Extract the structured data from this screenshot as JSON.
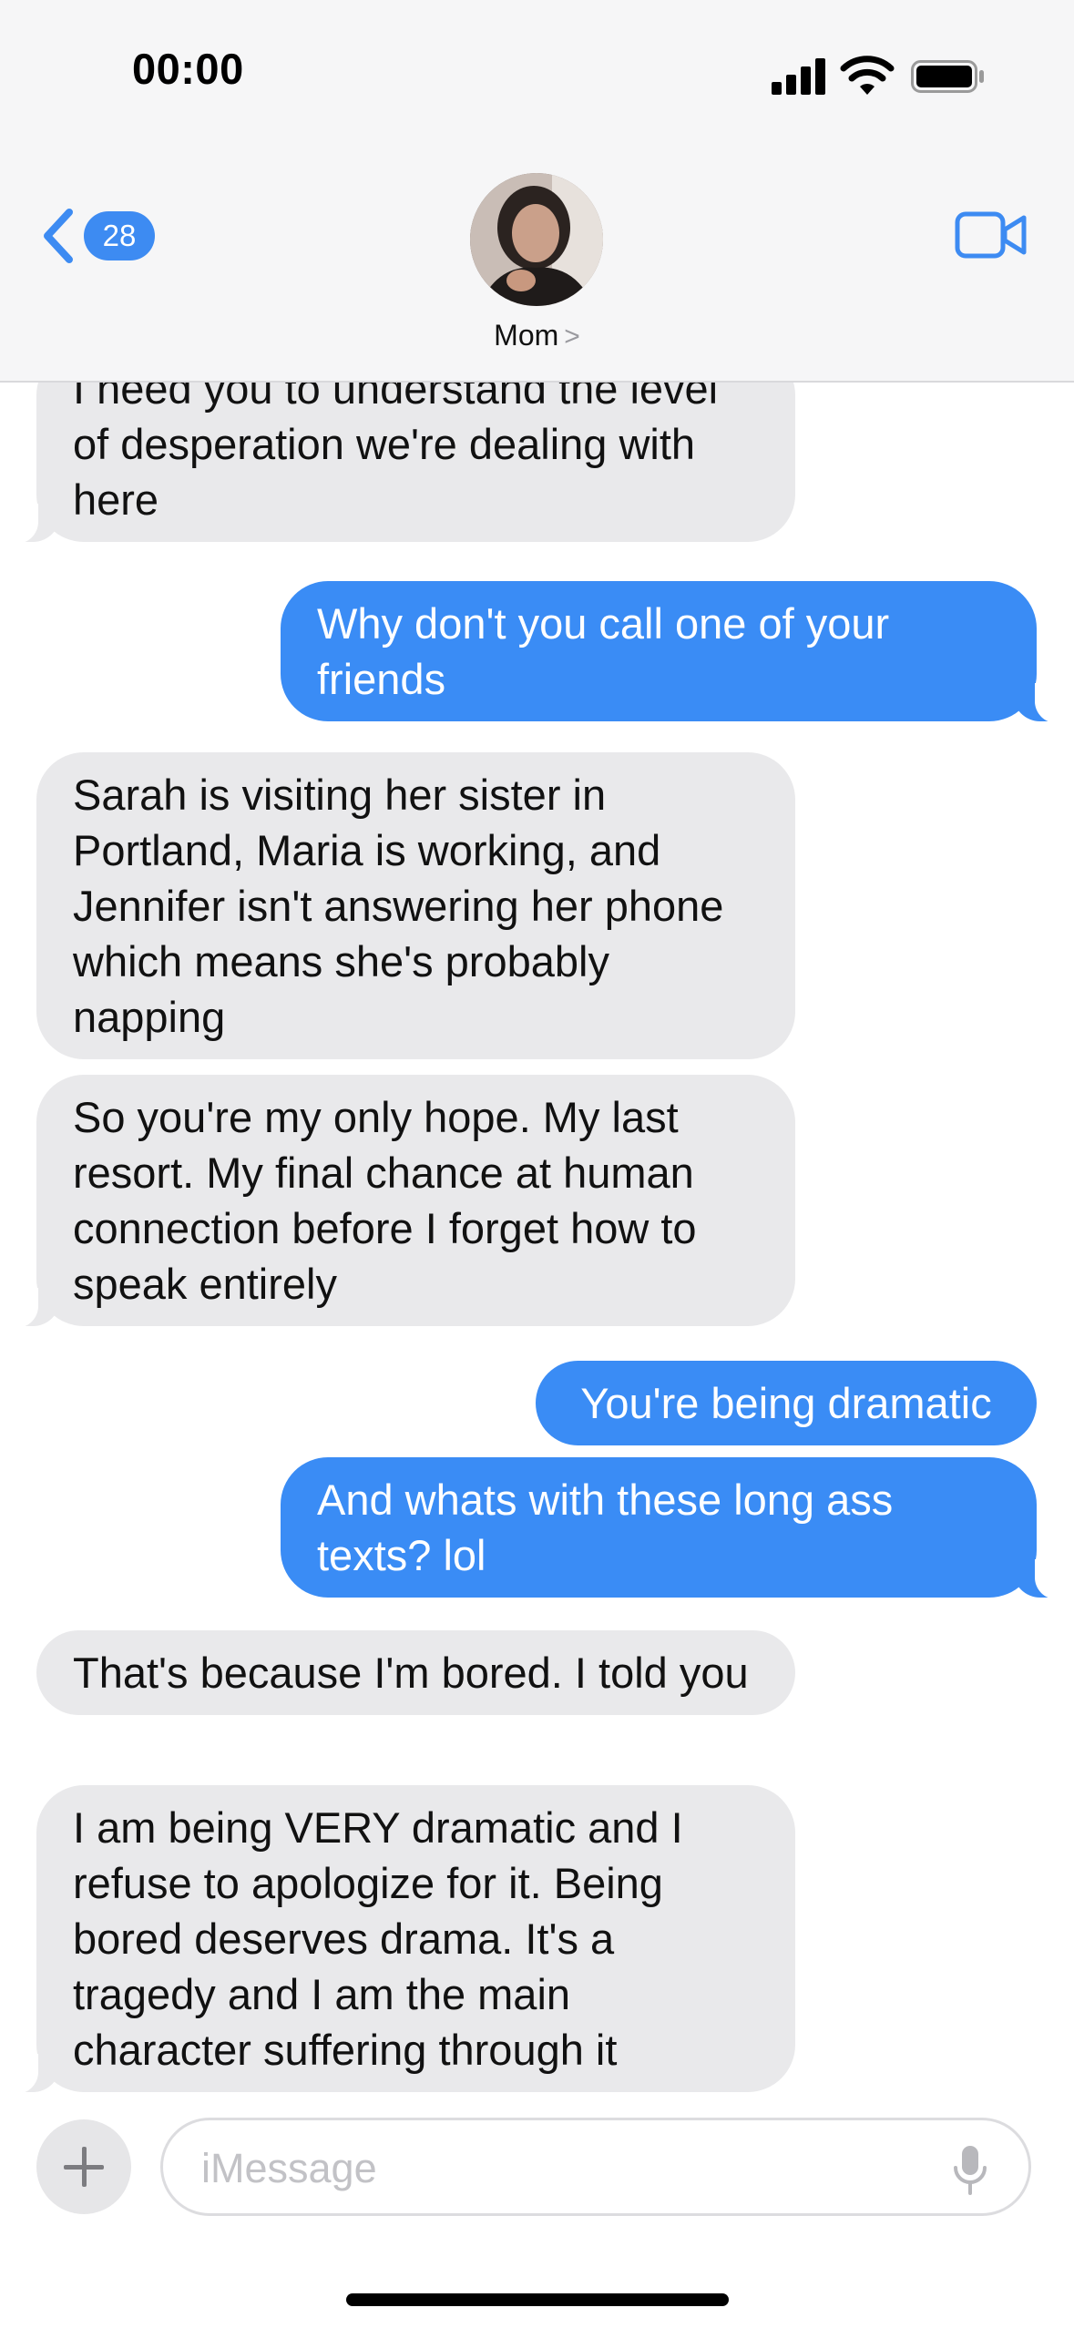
{
  "status_bar": {
    "time": "00:00"
  },
  "header": {
    "back_badge": "28",
    "contact_name": "Mom",
    "contact_chevron": ">"
  },
  "messages": [
    {
      "direction": "incoming",
      "text": "I need you to understand the level of desperation we're dealing with here"
    },
    {
      "direction": "outgoing",
      "text": "Why don't you call one of your friends"
    },
    {
      "direction": "incoming",
      "text": "Sarah is visiting her sister in Portland, Maria is working, and Jennifer isn't answering her phone which means she's probably napping"
    },
    {
      "direction": "incoming",
      "text": "So you're my only hope. My last resort. My final chance at human connection before I forget how to speak entirely"
    },
    {
      "direction": "outgoing",
      "text": "You're being dramatic"
    },
    {
      "direction": "outgoing",
      "text": "And whats with these long ass texts? lol"
    },
    {
      "direction": "incoming",
      "text": "That's because I'm bored. I told you"
    },
    {
      "direction": "incoming",
      "text": "I am being VERY dramatic and I refuse to apologize for it. Being bored deserves drama. It's a tragedy and I am the main character suffering through it"
    }
  ],
  "composer": {
    "placeholder": "iMessage",
    "value": ""
  },
  "colors": {
    "outgoing_bubble": "#3a8cf5",
    "incoming_bubble": "#e9e9eb",
    "accent": "#3d8bf2"
  },
  "icons": [
    "back-chevron-icon",
    "video-camera-icon",
    "plus-icon",
    "microphone-icon",
    "signal-icon",
    "wifi-icon",
    "battery-icon"
  ]
}
